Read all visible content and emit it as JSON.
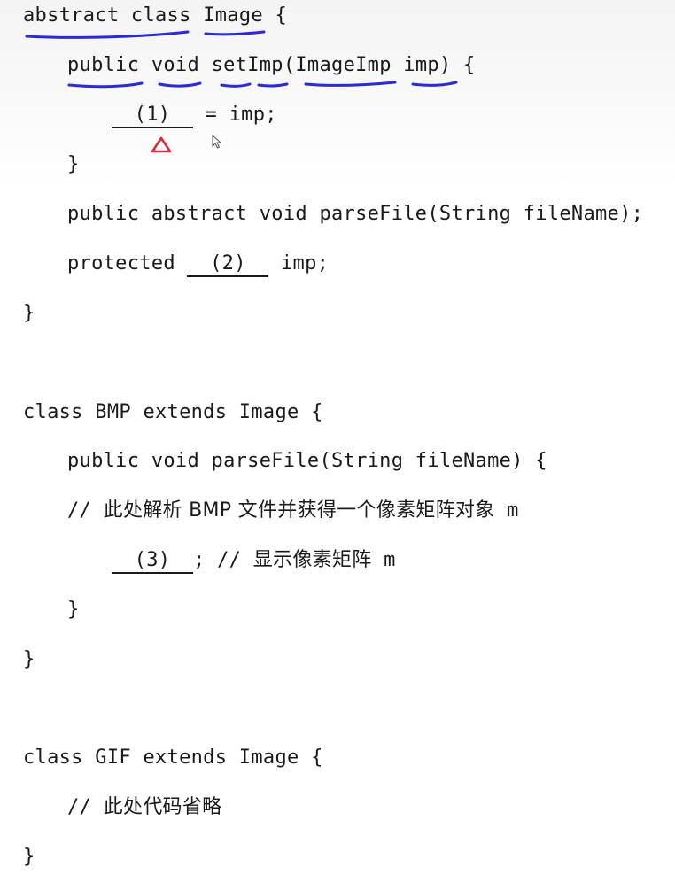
{
  "code": {
    "l1_kw": "abstract class",
    "l1_name": "Image",
    "l1_brace": "{",
    "l2": {
      "public": "public",
      "void": "void",
      "method": "setImp",
      "open": "(",
      "type": "ImageImp",
      "param": "imp",
      "close": ") {"
    },
    "blank1": "(1)",
    "l3_rest": "= imp;",
    "close_brace": "}",
    "l5": "public abstract void parseFile(String fileName);",
    "l6_kw": "protected",
    "blank2": "(2)",
    "l6_rest": "imp;",
    "l8": "class BMP extends Image {",
    "l9": "public void parseFile(String fileName) {",
    "l10_slash": "//",
    "l10_text": "此处解析 BMP 文件并获得一个像素矩阵对象",
    "l10_m": "m",
    "blank3": "(3)",
    "l11_semicolon": ";",
    "l11_slash": "//",
    "l11_text": "显示像素矩阵",
    "l11_m": "m",
    "l14": "class GIF extends Image {",
    "l15_slash": "//",
    "l15_text": "此处代码省略"
  },
  "colors": {
    "annotation_blue": "#2a2ad8",
    "annotation_red": "#e0283a",
    "text": "#1a1a1a"
  },
  "icons": {
    "cursor": "mouse-pointer-icon",
    "mark": "triangle-mark-icon"
  }
}
